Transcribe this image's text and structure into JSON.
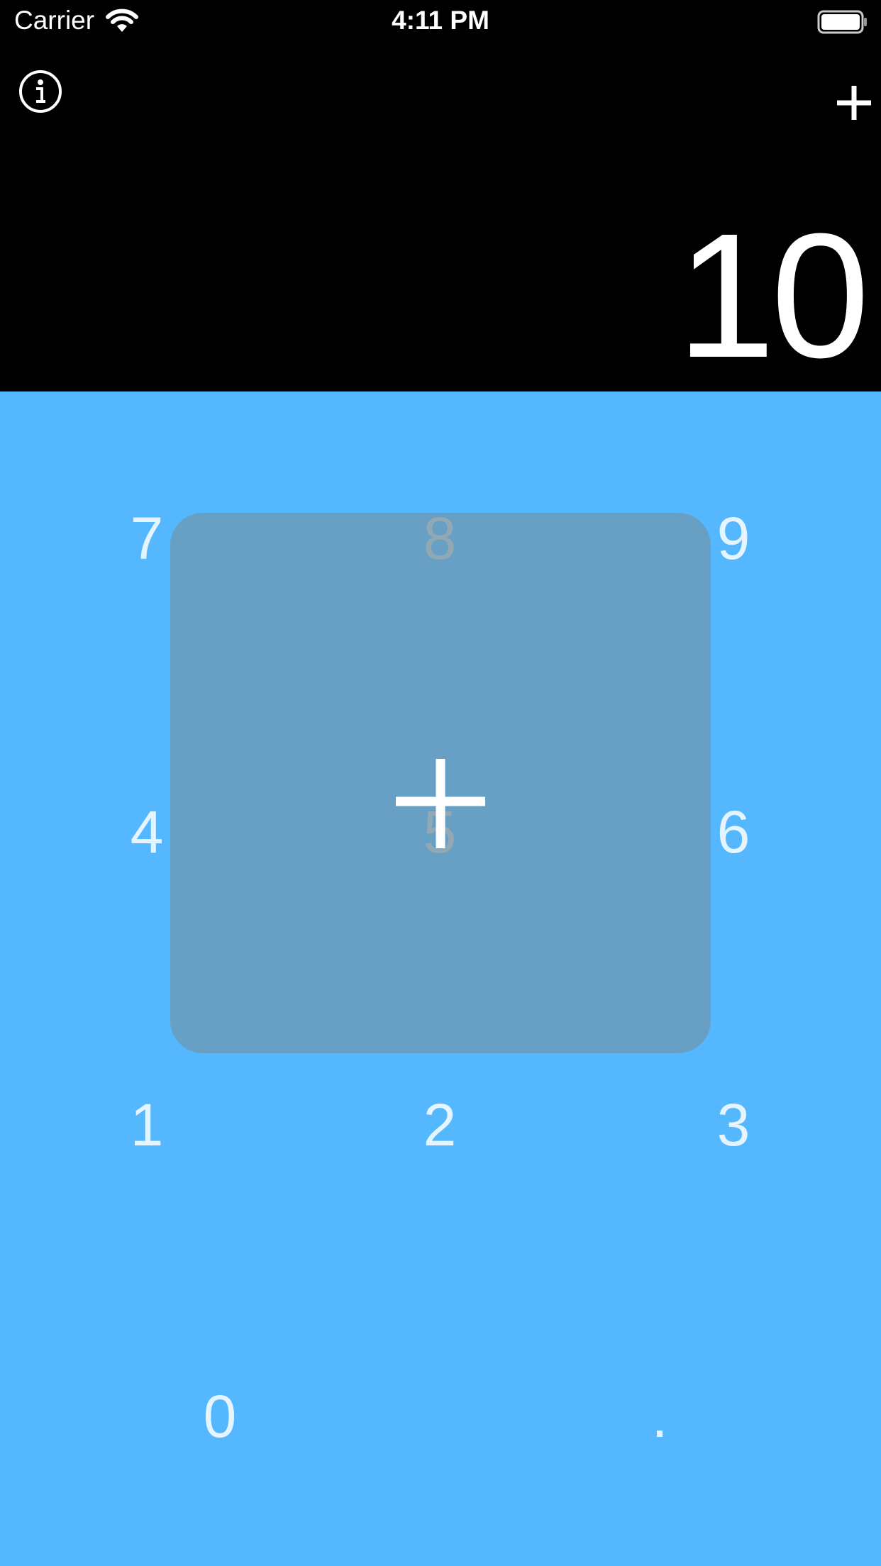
{
  "status_bar": {
    "carrier": "Carrier",
    "time": "4:11 PM",
    "wifi_icon": "wifi-icon",
    "battery_icon": "battery-icon"
  },
  "header": {
    "info_icon": "info-icon",
    "add_icon": "plus-icon"
  },
  "display": {
    "value": "10"
  },
  "keypad": {
    "keys": {
      "seven": "7",
      "eight": "8",
      "nine": "9",
      "four": "4",
      "five": "5",
      "six": "6",
      "one": "1",
      "two": "2",
      "three": "3",
      "zero": "0",
      "dot": "."
    },
    "overlay_icon": "plus-icon"
  },
  "colors": {
    "header_bg": "#000000",
    "keypad_bg": "#55b8fe",
    "overlay": "#6c9fc2",
    "text": "#ffffff"
  }
}
